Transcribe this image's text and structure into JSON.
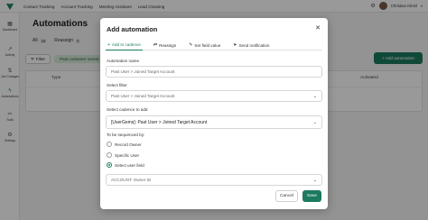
{
  "topbar": {
    "nav": [
      "Contact Tracking",
      "Account Tracking",
      "Meeting Assistant",
      "Lead Cleaning"
    ],
    "user_name": "Christian Kletzl"
  },
  "sidebar": {
    "items": [
      {
        "label": "Dashboard",
        "icon": "dashboard-icon"
      },
      {
        "label": "Activity",
        "icon": "activity-icon"
      },
      {
        "label": "Job Changes",
        "icon": "job-changes-icon"
      },
      {
        "label": "Automations",
        "icon": "automations-icon"
      },
      {
        "label": "Tools",
        "icon": "tools-icon"
      },
      {
        "label": "Settings",
        "icon": "settings-icon"
      }
    ]
  },
  "main": {
    "title": "Automations",
    "tabs": [
      {
        "label": "All",
        "count": "18"
      },
      {
        "label": "Reassign",
        "count": "0"
      }
    ],
    "filter_label": "Filter",
    "filter_chip": "Past customer recent",
    "add_button": "+ Add automation",
    "table_headers": {
      "type": "Type",
      "activated": "Activated"
    }
  },
  "modal": {
    "title": "Add automation",
    "tabs": [
      {
        "label": "Add to cadence",
        "icon": "+"
      },
      {
        "label": "Reassign",
        "icon": "⇄"
      },
      {
        "label": "Set field value",
        "icon": "✎"
      },
      {
        "label": "Send notification",
        "icon": "➤"
      }
    ],
    "name_label": "Automation name",
    "name_placeholder": "Past User > Joined Target Account",
    "filter_label": "Select filter",
    "filter_value": "Past User > Joined Target Account",
    "cadence_label": "Select cadence to add",
    "cadence_value": "[UserGems]: Past User > Joined Target Account",
    "sequenced_label": "To be sequenced by:",
    "options": [
      "Record Owner",
      "Specific User",
      "Select user field"
    ],
    "selected_option": 2,
    "user_field_value": "ACCOUNT: Owner ID",
    "cancel_label": "Cancel",
    "save_label": "Save"
  },
  "colors": {
    "accent": "#1d7a5f",
    "chip_bg": "#d5ead8"
  }
}
